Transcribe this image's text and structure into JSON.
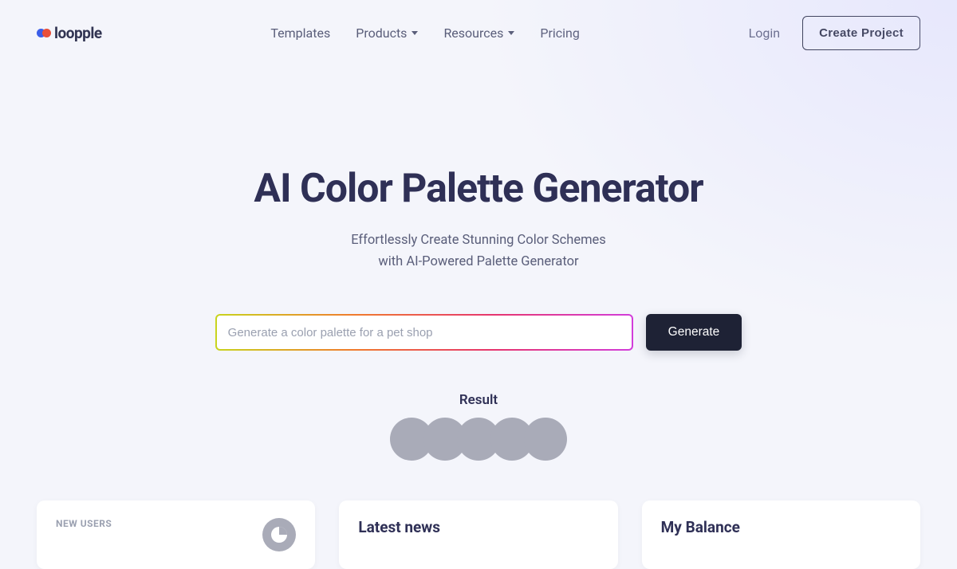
{
  "brand": {
    "name": "loopple"
  },
  "nav": {
    "templates": "Templates",
    "products": "Products",
    "resources": "Resources",
    "pricing": "Pricing",
    "login": "Login",
    "create": "Create Project"
  },
  "hero": {
    "title": "AI Color Palette Generator",
    "subtitle_line1": "Effortlessly Create Stunning Color Schemes",
    "subtitle_line2": "with AI-Powered Palette Generator"
  },
  "generator": {
    "placeholder": "Generate a color palette for a pet shop",
    "button": "Generate"
  },
  "result": {
    "label": "Result"
  },
  "cards": {
    "new_users_label": "NEW USERS",
    "latest_news": "Latest news",
    "my_balance": "My Balance"
  }
}
